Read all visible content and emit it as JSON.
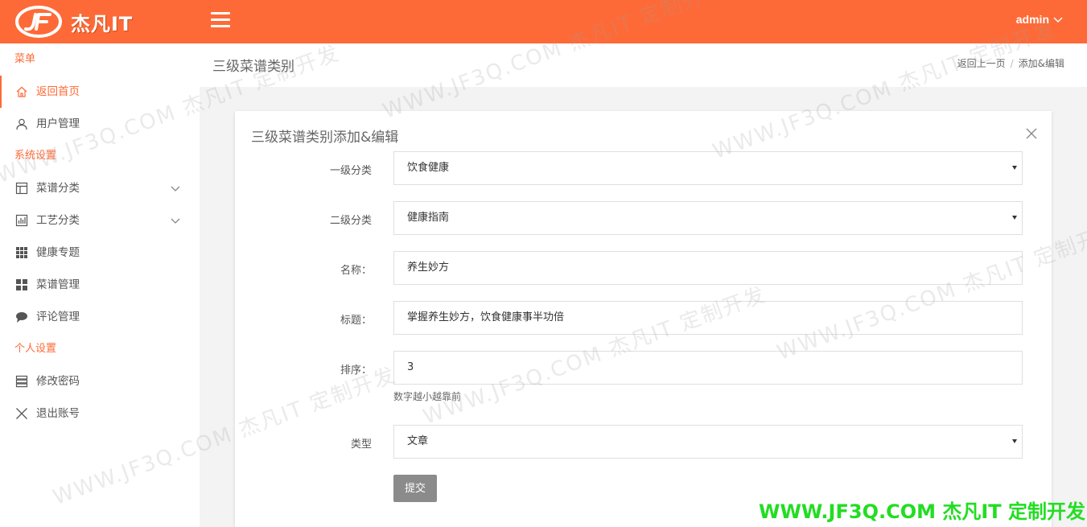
{
  "brand": {
    "logo_text": "杰凡IT"
  },
  "header": {
    "user": "admin"
  },
  "sidebar": {
    "sections": [
      {
        "title": "菜单",
        "items": [
          {
            "label": "返回首页",
            "icon": "home-icon"
          },
          {
            "label": "用户管理",
            "icon": "user-icon"
          }
        ]
      },
      {
        "title": "系统设置",
        "items": [
          {
            "label": "菜谱分类",
            "icon": "layout-icon"
          },
          {
            "label": "工艺分类",
            "icon": "chart-icon"
          },
          {
            "label": "健康专题",
            "icon": "grid-icon"
          },
          {
            "label": "菜谱管理",
            "icon": "tiles-icon"
          },
          {
            "label": "评论管理",
            "icon": "comment-icon"
          }
        ]
      },
      {
        "title": "个人设置",
        "items": [
          {
            "label": "修改密码",
            "icon": "list-icon"
          },
          {
            "label": "退出账号",
            "icon": "close-icon"
          }
        ]
      }
    ]
  },
  "page": {
    "title": "三级菜谱类别",
    "breadcrumb": {
      "back": "返回上一页",
      "current": "添加&编辑"
    }
  },
  "panel": {
    "title": "三级菜谱类别添加&编辑",
    "fields": {
      "level1": {
        "label": "一级分类",
        "value": "饮食健康"
      },
      "level2": {
        "label": "二级分类",
        "value": "健康指南"
      },
      "name": {
        "label": "名称：",
        "value": "养生妙方"
      },
      "heading": {
        "label": "标题：",
        "value": "掌握养生妙方，饮食健康事半功倍"
      },
      "sort": {
        "label": "排序：",
        "value": "3",
        "hint": "数字越小越靠前"
      },
      "type": {
        "label": "类型",
        "value": "文章"
      }
    },
    "submit": "提交"
  },
  "watermark": {
    "text": "WWW.JF3Q.COM 杰凡IT 定制开发",
    "banner": "WWW.JF3Q.COM 杰凡IT  定制开发"
  },
  "colors": {
    "accent": "#fe6a37",
    "banner": "#22dd22"
  }
}
